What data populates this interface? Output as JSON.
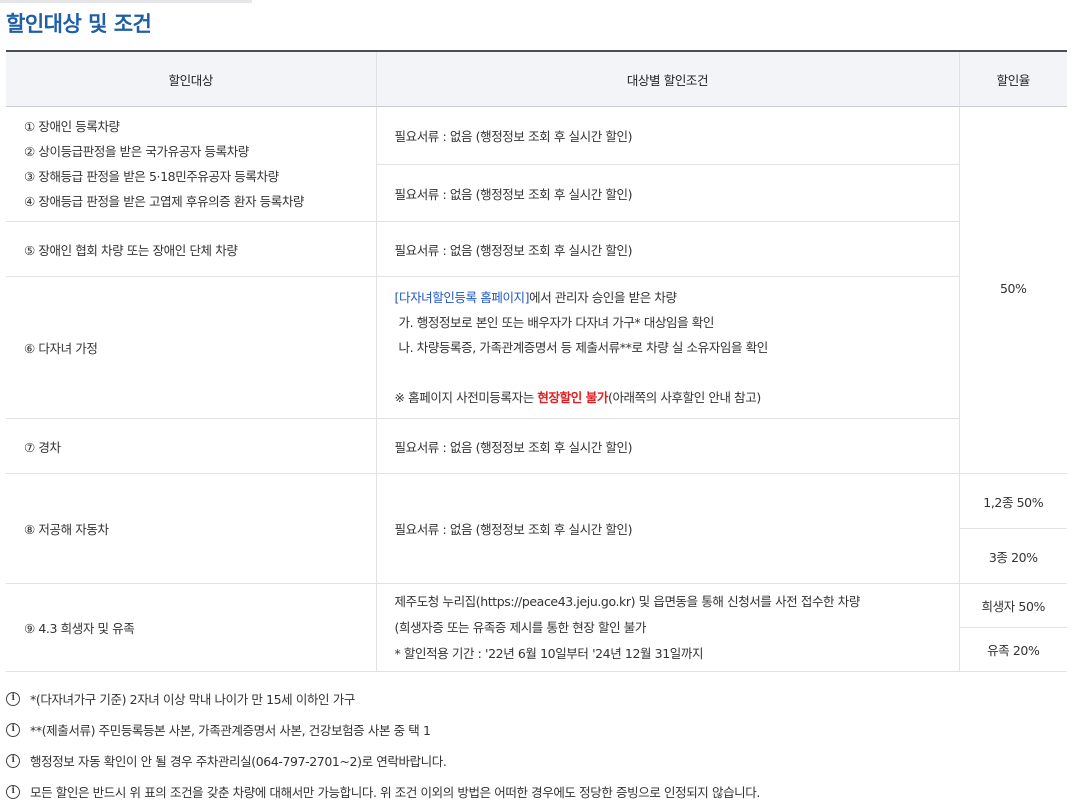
{
  "title": "할인대상 및 조건",
  "headers": {
    "target": "할인대상",
    "condition": "대상별 할인조건",
    "rate": "할인율"
  },
  "rows": {
    "r1": {
      "targets": [
        "① 장애인 등록차량",
        "② 상이등급판정을 받은 국가유공자 등록차량",
        "③ 장해등급 판정을 받은 5·18민주유공자 등록차량",
        "④ 장애등급 판정을 받은 고엽제 후유의증 환자 등록차량"
      ],
      "conditions": [
        "필요서류 : 없음 (행정정보 조회 후 실시간 할인)",
        "필요서류 : 없음 (행정정보 조회 후 실시간 할인)"
      ]
    },
    "r5": {
      "target": "⑤ 장애인 협회 차량 또는 장애인 단체 차량",
      "condition": "필요서류 : 없음 (행정정보 조회 후 실시간 할인)"
    },
    "r6": {
      "target": "⑥ 다자녀 가정",
      "line1_link": "[다자녀할인등록 홈페이지]",
      "line1_rest": "에서 관리자 승인을 받은 차량",
      "line2": "가. 행정정보로 본인 또는 배우자가 다자녀 가구* 대상임을 확인",
      "line3": "나. 차량등록증, 가족관계증명서 등 제출서류**로 차량 실 소유자임을 확인",
      "note_prefix": "※ 홈페이지 사전미등록자는 ",
      "note_red": "현장할인 불가",
      "note_suffix": "(아래쪽의 사후할인 안내 참고)"
    },
    "r7": {
      "target": "⑦ 경차",
      "condition": "필요서류 : 없음 (행정정보 조회 후 실시간 할인)"
    },
    "shared_rate": "50%",
    "r8": {
      "target": "⑧ 저공해 자동차",
      "condition": "필요서류 : 없음 (행정정보 조회 후 실시간 할인)",
      "rate1": "1,2종 50%",
      "rate2": "3종 20%"
    },
    "r9": {
      "target": "⑨ 4.3 희생자 및 유족",
      "line1": "제주도청 누리집(https://peace43.jeju.go.kr) 및 읍면동을 통해 신청서를 사전 접수한 차량",
      "line2": "(희생자증 또는 유족증 제시를 통한 현장 할인 불가",
      "line3": "* 할인적용 기간 : '22년 6월 10일부터 '24년 12월 31일까지",
      "rate1": "희생자 50%",
      "rate2": "유족 20%"
    }
  },
  "notes": [
    "*(다자녀가구 기준) 2자녀 이상 막내 나이가 만 15세 이하인 가구",
    "**(제출서류) 주민등록등본 사본, 가족관계증명서 사본, 건강보험증 사본 중 택 1",
    "행정정보 자동 확인이 안 될 경우 주차관리실(064-797-2701~2)로 연락바랍니다.",
    "모든 할인은 반드시 위 표의 조건을 갖춘 차량에 대해서만 가능합니다. 위 조건 이외의 방법은 어떠한 경우에도 정당한 증빙으로 인정되지 않습니다."
  ],
  "icons": {
    "note_icon": "info-circle-icon"
  }
}
